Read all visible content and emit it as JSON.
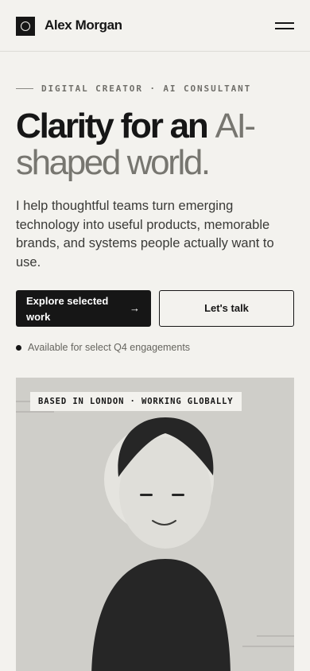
{
  "header": {
    "brand": "Alex Morgan",
    "logo_icon": "circle-logo-icon",
    "menu_icon": "hamburger-menu-icon"
  },
  "hero": {
    "eyebrow": "DIGITAL CREATOR · AI CONSULTANT",
    "headline_strong": "Clarity for an",
    "headline_muted": "AI-shaped world.",
    "lead": "I help thoughtful teams turn emerging technology into useful products, memorable brands, and systems people actually want to use.",
    "primary_cta": "Explore selected work",
    "primary_cta_icon": "arrow-right-icon",
    "secondary_cta": "Let's talk",
    "availability": "Available for select Q4 engagements"
  },
  "portrait": {
    "tag": "BASED IN LONDON · WORKING GLOBALLY"
  },
  "colors": {
    "background": "#f3f2ee",
    "ink": "#161616",
    "muted": "#777670",
    "card": "#cfcec9"
  }
}
